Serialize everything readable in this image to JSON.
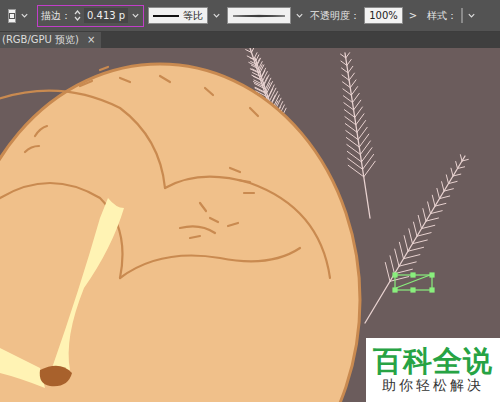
{
  "toolbar": {
    "stroke_label": "描边：",
    "stroke_value": "0.413 p",
    "profile_label": "等比",
    "opacity_label": "不透明度：",
    "opacity_value": "100%",
    "opacity_arrow": ">",
    "style_label": "样式："
  },
  "document_tab": {
    "title": "(RGB/GPU 预览)",
    "close": "×"
  },
  "watermark": {
    "title": "百科全说",
    "subtitle": "助你轻松解决"
  }
}
